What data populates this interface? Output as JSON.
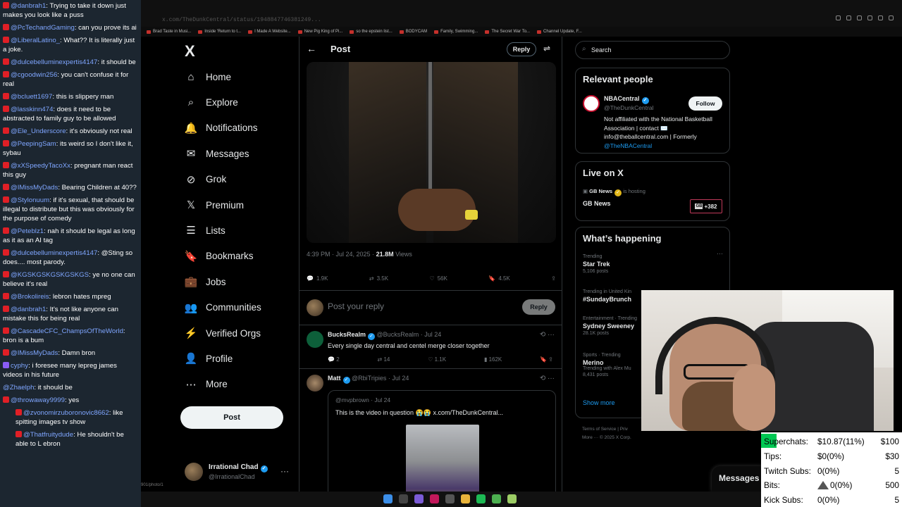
{
  "browser": {
    "url": "x.com/TheDunkCentral/status/1948847746381249...",
    "bookmarks": [
      "Brad Taste in Musi...",
      "Inside 'Return to t...",
      "I Made A Website...",
      "New Pig King of Pi...",
      "so the epstein list...",
      "BODYCAM",
      "Family, Swimming...",
      "The Secret War To...",
      "Channel Update, F..."
    ],
    "statusbar_path": "901/photo/1"
  },
  "nav": {
    "logo": "X",
    "items": [
      {
        "label": "Home",
        "icon": "⌂"
      },
      {
        "label": "Explore",
        "icon": "⌕"
      },
      {
        "label": "Notifications",
        "icon": "🔔"
      },
      {
        "label": "Messages",
        "icon": "✉"
      },
      {
        "label": "Grok",
        "icon": "⊘"
      },
      {
        "label": "Premium",
        "icon": "𝕏"
      },
      {
        "label": "Lists",
        "icon": "☰"
      },
      {
        "label": "Bookmarks",
        "icon": "🔖"
      },
      {
        "label": "Jobs",
        "icon": "💼"
      },
      {
        "label": "Communities",
        "icon": "👥"
      },
      {
        "label": "Verified Orgs",
        "icon": "⚡"
      },
      {
        "label": "Profile",
        "icon": "👤"
      },
      {
        "label": "More",
        "icon": "⋯"
      }
    ],
    "post_button": "Post",
    "profile": {
      "name": "Irrational Chad",
      "handle": "@IrrationalChad",
      "more": "···"
    }
  },
  "post": {
    "header_title": "Post",
    "reply_button": "Reply",
    "time": "4:39 PM · Jul 24, 2025 · ",
    "views_count": "21.8M",
    "views_label": " Views",
    "stats": {
      "replies": "1.9K",
      "reposts": "3.5K",
      "likes": "56K",
      "bookmarks": "4.5K"
    },
    "compose_placeholder": "Post your reply",
    "compose_button": "Reply"
  },
  "replies": [
    {
      "name": "BucksRealm",
      "handle": "@BucksRealm · Jul 24",
      "text": "Every single day central and centel merge closer together",
      "actions": {
        "replies": "2",
        "reposts": "14",
        "likes": "1.1K",
        "views": "162K"
      }
    },
    {
      "name": "Matt",
      "handle": "@RbiTripies · Jul 24",
      "quote_handle": "@mvpbrown · Jul 24",
      "quote_text": "This is the video in question 😭😭 x.com/TheDunkCentral..."
    }
  ],
  "sidebar": {
    "search_placeholder": "Search",
    "relevant_title": "Relevant people",
    "relevant": {
      "name": "NBACentral",
      "handle": "@TheDunkCentral",
      "follow": "Follow",
      "bio": "Not affiliated with the National Basketball Association | contact ✉️ info@theballcentral.com | Formerly ",
      "bio_link": "@TheNBACentral"
    },
    "live_title": "Live on X",
    "live_host_name": "GB News",
    "live_host_suffix": " is hosting",
    "live_name": "GB News",
    "live_mini": "GB",
    "live_count": "+382",
    "happening_title": "What’s happening",
    "trends": [
      {
        "cat": "Trending",
        "name": "Star Trek",
        "count": "5,106 posts"
      },
      {
        "cat": "Trending in United Kin",
        "name": "#SundayBrunch",
        "count": ""
      },
      {
        "cat": "Entertainment · Trending",
        "name": "Sydney Sweeney",
        "count": "28.1K posts"
      },
      {
        "cat": "Sports · Trending",
        "name": "Merino",
        "count": "8,431 posts",
        "extra": "Trending with Alex Mu"
      }
    ],
    "show_more": "Show more",
    "footer": [
      "Terms of Service  |  Priv",
      "More ···  © 2025 X Corp."
    ],
    "messages_drawer": "Messages"
  },
  "chat": [
    {
      "badge": "red",
      "user": "@danbrah1",
      "text": "Trying to take it down just makes you look like a puss"
    },
    {
      "badge": "red",
      "user": "@PcTechandGaming",
      "text": "can you prove its ai"
    },
    {
      "badge": "red",
      "user": "@LiberalLatino_",
      "text": "What?? It is literally just a joke."
    },
    {
      "badge": "red",
      "user": "@dulcebelluminexpertis4147",
      "text": "it should be"
    },
    {
      "badge": "red",
      "user": "@cgoodwin256",
      "text": "you can't confuse it for real"
    },
    {
      "badge": "red",
      "user": "@bcluett1697",
      "text": "this is slippery man"
    },
    {
      "badge": "red",
      "user": "@lasskinn474",
      "text": "does it need to be abstracted to family guy to be allowed"
    },
    {
      "badge": "red",
      "user": "@Ele_Underscore",
      "text": "it's obviously not real"
    },
    {
      "badge": "red",
      "user": "@PeepingSam",
      "text": "its weird so I don't like it, sybau"
    },
    {
      "badge": "red",
      "user": "@xXSpeedyTacoXx",
      "text": "pregnant man react this guy"
    },
    {
      "badge": "red",
      "user": "@IMissMyDads",
      "text": "Bearing Children at 40??"
    },
    {
      "badge": "red",
      "user": "@Stylonuum",
      "text": "if it's sexual, that should be illegal to distribute but this was obviously for the purpose of comedy"
    },
    {
      "badge": "red",
      "user": "@Peteblz1",
      "text": "nah it should be legal as long as it as an AI tag"
    },
    {
      "badge": "red",
      "user": "@dulcebelluminexpertis4147",
      "text": "@Sting so does.... most parody."
    },
    {
      "badge": "red",
      "user": "@KGSKGSKGSKGSKGS",
      "text": "ye no one can believe it's real"
    },
    {
      "badge": "red",
      "user": "@Brokolireis",
      "text": "lebron hates mpreg"
    },
    {
      "badge": "red",
      "user": "@danbrah1",
      "text": "It's not like anyone can mistake this for being real"
    },
    {
      "badge": "red",
      "user": "@CascadeCFC_ChampsOfTheWorld",
      "text": "bron is a bum"
    },
    {
      "badge": "red",
      "user": "@IMissMyDads",
      "text": "Damn bron"
    },
    {
      "badge": "purple",
      "user": "cyphy",
      "text": "i foresee many lepreg james videos in his future"
    },
    {
      "badge": "none",
      "user": "@Zhaelph",
      "text": "it should be"
    },
    {
      "badge": "red",
      "user": "@throwaway9999",
      "text": "yes"
    },
    {
      "badge": "red",
      "user": "@zvonomirzuboronovic8662",
      "text": "like spitting images tv show",
      "indent": true
    },
    {
      "badge": "red",
      "user": "@Thatfruitydude",
      "text": "He shouldn't be able to L ebron",
      "indent": true
    }
  ],
  "stats_overlay": {
    "superchats": {
      "label": "Superchats:",
      "value": "$10.87(11%)",
      "goal": "$100",
      "progress": 0.11
    },
    "tips": {
      "label": "Tips:",
      "value": "$0(0%)",
      "goal": "$30",
      "progress": 0
    },
    "twitch": {
      "label": "Twitch Subs:",
      "value": "0(0%)",
      "goal": "5",
      "progress": 0
    },
    "bits": {
      "label": "Bits:",
      "value": "0(0%)",
      "goal": "500",
      "progress": 0
    },
    "kick": {
      "label": "Kick Subs:",
      "value": "0(0%)",
      "goal": "5",
      "progress": 0
    }
  },
  "colors": {
    "accent": "#1d9bf0",
    "chat_bg": "#1c2630",
    "progress_fill": "#00c853",
    "live_border": "#c13a5a"
  }
}
